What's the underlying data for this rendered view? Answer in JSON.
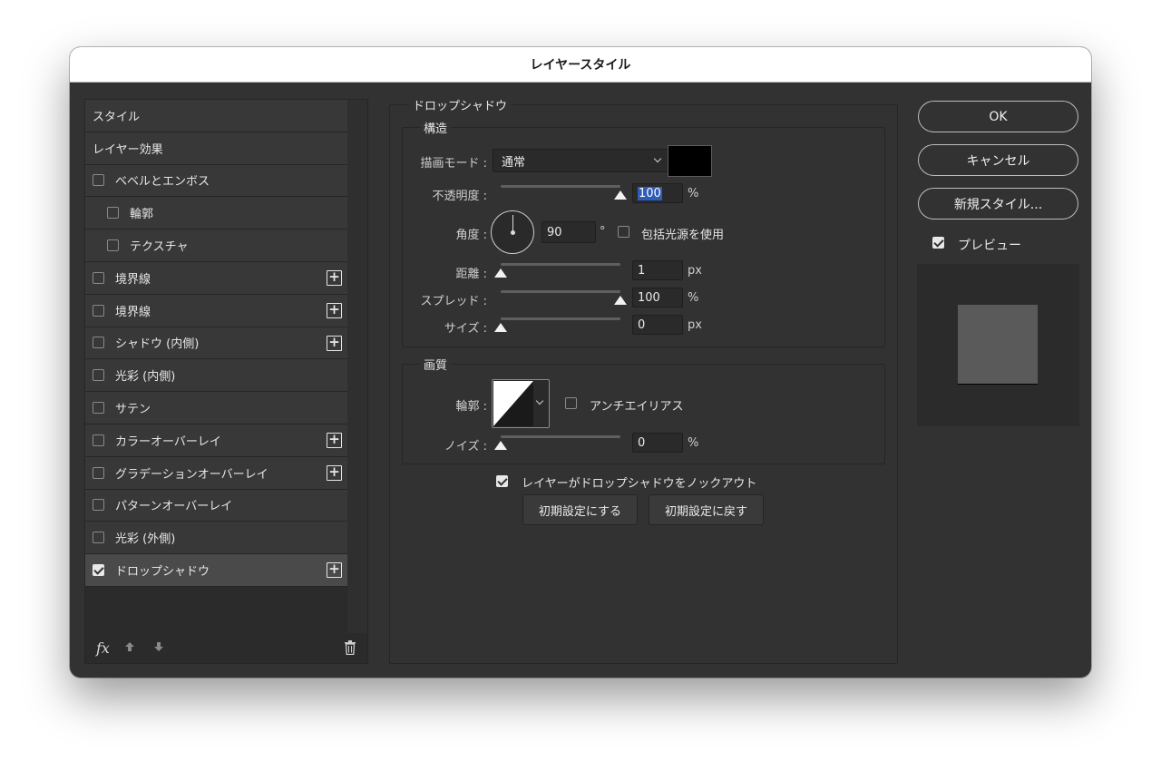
{
  "window": {
    "title": "レイヤースタイル"
  },
  "styles_list": {
    "items": [
      {
        "label": "スタイル",
        "checkbox": false,
        "checked": false,
        "plus": false,
        "selected": false,
        "indent": false
      },
      {
        "label": "レイヤー効果",
        "checkbox": false,
        "checked": false,
        "plus": false,
        "selected": false,
        "indent": false
      },
      {
        "label": "ベベルとエンボス",
        "checkbox": true,
        "checked": false,
        "plus": false,
        "selected": false,
        "indent": false
      },
      {
        "label": "輪郭",
        "checkbox": true,
        "checked": false,
        "plus": false,
        "selected": false,
        "indent": true
      },
      {
        "label": "テクスチャ",
        "checkbox": true,
        "checked": false,
        "plus": false,
        "selected": false,
        "indent": true
      },
      {
        "label": "境界線",
        "checkbox": true,
        "checked": false,
        "plus": true,
        "selected": false,
        "indent": false
      },
      {
        "label": "境界線",
        "checkbox": true,
        "checked": false,
        "plus": true,
        "selected": false,
        "indent": false
      },
      {
        "label": "シャドウ (内側)",
        "checkbox": true,
        "checked": false,
        "plus": true,
        "selected": false,
        "indent": false
      },
      {
        "label": "光彩 (内側)",
        "checkbox": true,
        "checked": false,
        "plus": false,
        "selected": false,
        "indent": false
      },
      {
        "label": "サテン",
        "checkbox": true,
        "checked": false,
        "plus": false,
        "selected": false,
        "indent": false
      },
      {
        "label": "カラーオーバーレイ",
        "checkbox": true,
        "checked": false,
        "plus": true,
        "selected": false,
        "indent": false
      },
      {
        "label": "グラデーションオーバーレイ",
        "checkbox": true,
        "checked": false,
        "plus": true,
        "selected": false,
        "indent": false
      },
      {
        "label": "パターンオーバーレイ",
        "checkbox": true,
        "checked": false,
        "plus": false,
        "selected": false,
        "indent": false
      },
      {
        "label": "光彩 (外側)",
        "checkbox": true,
        "checked": false,
        "plus": false,
        "selected": false,
        "indent": false
      },
      {
        "label": "ドロップシャドウ",
        "checkbox": true,
        "checked": true,
        "plus": true,
        "selected": true,
        "indent": false
      }
    ],
    "footer": {
      "fx_label": "fx",
      "up_icon": "arrow-up-icon",
      "down_icon": "arrow-down-icon",
      "trash_icon": "trash-icon"
    }
  },
  "drop_shadow": {
    "section_title": "ドロップシャドウ",
    "structure": {
      "title": "構造",
      "blend_mode_label": "描画モード :",
      "blend_mode_value": "通常",
      "shadow_color": "#000000",
      "opacity_label": "不透明度 :",
      "opacity_value": "100",
      "opacity_unit": "%",
      "opacity_level": 1.0,
      "angle_label": "角度 :",
      "angle_value": "90",
      "angle_unit": "°",
      "global_light_label": "包括光源を使用",
      "global_light_checked": false,
      "distance_label": "距離 :",
      "distance_value": "1",
      "distance_unit": "px",
      "distance_level": 0.0,
      "spread_label": "スプレッド :",
      "spread_value": "100",
      "spread_unit": "%",
      "spread_level": 1.0,
      "size_label": "サイズ :",
      "size_value": "0",
      "size_unit": "px",
      "size_level": 0.0
    },
    "quality": {
      "title": "画質",
      "contour_label": "輪郭 :",
      "antialias_label": "アンチエイリアス",
      "antialias_checked": false,
      "noise_label": "ノイズ :",
      "noise_value": "0",
      "noise_unit": "%",
      "noise_level": 0.0
    },
    "knockout_label": "レイヤーがドロップシャドウをノックアウト",
    "knockout_checked": true,
    "make_default_label": "初期設定にする",
    "reset_default_label": "初期設定に戻す"
  },
  "right_panel": {
    "ok_label": "OK",
    "cancel_label": "キャンセル",
    "new_style_label": "新規スタイル...",
    "preview_label": "プレビュー",
    "preview_checked": true
  },
  "colors": {
    "dialog_bg": "#323232",
    "accent_highlight": "#2e5cb8"
  }
}
